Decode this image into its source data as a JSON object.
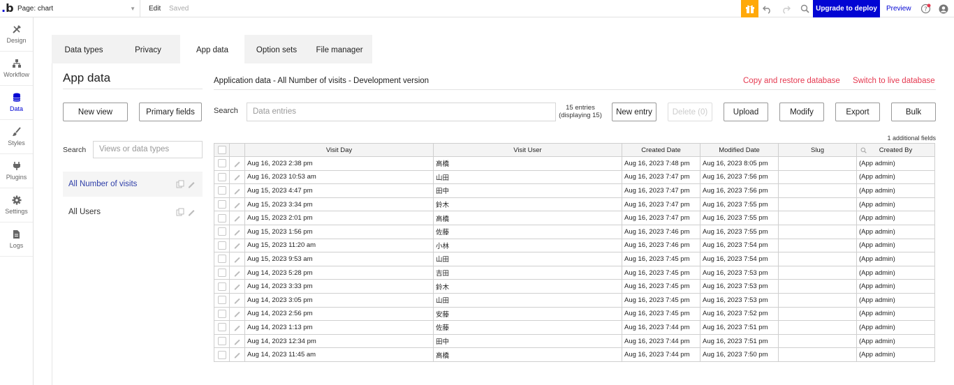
{
  "topbar": {
    "logo": "b",
    "page_label": "Page: chart",
    "edit": "Edit",
    "saved": "Saved",
    "upgrade": "Upgrade to deploy",
    "preview": "Preview",
    "accent": "#0205d3",
    "gift_color": "#ffa90a"
  },
  "rail": [
    {
      "label": "Design",
      "icon": "design-icon"
    },
    {
      "label": "Workflow",
      "icon": "workflow-icon"
    },
    {
      "label": "Data",
      "icon": "database-icon"
    },
    {
      "label": "Styles",
      "icon": "brush-icon"
    },
    {
      "label": "Plugins",
      "icon": "plug-icon"
    },
    {
      "label": "Settings",
      "icon": "gear-icon"
    },
    {
      "label": "Logs",
      "icon": "document-icon"
    }
  ],
  "tabs": [
    "Data types",
    "Privacy",
    "App data",
    "Option sets",
    "File manager"
  ],
  "left": {
    "title": "App data",
    "new_view": "New view",
    "primary_fields": "Primary fields",
    "search_label": "Search",
    "search_placeholder": "Views or data types",
    "items": [
      "All Number of visits",
      "All Users"
    ]
  },
  "right": {
    "header": "Application data - All Number of visits - Development version",
    "copy_restore": "Copy and restore database",
    "switch_live": "Switch to live database",
    "search_label": "Search",
    "search_placeholder": "Data entries",
    "entries_line1": "15 entries",
    "entries_line2": "(displaying 15)",
    "buttons": {
      "new_entry": "New entry",
      "delete": "Delete (0)",
      "upload": "Upload",
      "modify": "Modify",
      "export": "Export",
      "bulk": "Bulk"
    },
    "additional_fields": "1 additional fields",
    "columns": [
      "Visit Day",
      "Visit User",
      "Created Date",
      "Modified Date",
      "Slug",
      "Created By"
    ],
    "rows": [
      [
        "Aug 16, 2023 2:38 pm",
        "高橋",
        "Aug 16, 2023 7:48 pm",
        "Aug 16, 2023 8:05 pm",
        "",
        "(App admin)"
      ],
      [
        "Aug 16, 2023 10:53 am",
        "山田",
        "Aug 16, 2023 7:47 pm",
        "Aug 16, 2023 7:56 pm",
        "",
        "(App admin)"
      ],
      [
        "Aug 15, 2023 4:47 pm",
        "田中",
        "Aug 16, 2023 7:47 pm",
        "Aug 16, 2023 7:56 pm",
        "",
        "(App admin)"
      ],
      [
        "Aug 15, 2023 3:34 pm",
        "鈴木",
        "Aug 16, 2023 7:47 pm",
        "Aug 16, 2023 7:55 pm",
        "",
        "(App admin)"
      ],
      [
        "Aug 15, 2023 2:01 pm",
        "高橋",
        "Aug 16, 2023 7:47 pm",
        "Aug 16, 2023 7:55 pm",
        "",
        "(App admin)"
      ],
      [
        "Aug 15, 2023 1:56 pm",
        "佐藤",
        "Aug 16, 2023 7:46 pm",
        "Aug 16, 2023 7:55 pm",
        "",
        "(App admin)"
      ],
      [
        "Aug 15, 2023 11:20 am",
        "小林",
        "Aug 16, 2023 7:46 pm",
        "Aug 16, 2023 7:54 pm",
        "",
        "(App admin)"
      ],
      [
        "Aug 15, 2023 9:53 am",
        "山田",
        "Aug 16, 2023 7:45 pm",
        "Aug 16, 2023 7:54 pm",
        "",
        "(App admin)"
      ],
      [
        "Aug 14, 2023 5:28 pm",
        "吉田",
        "Aug 16, 2023 7:45 pm",
        "Aug 16, 2023 7:53 pm",
        "",
        "(App admin)"
      ],
      [
        "Aug 14, 2023 3:33 pm",
        "鈴木",
        "Aug 16, 2023 7:45 pm",
        "Aug 16, 2023 7:53 pm",
        "",
        "(App admin)"
      ],
      [
        "Aug 14, 2023 3:05 pm",
        "山田",
        "Aug 16, 2023 7:45 pm",
        "Aug 16, 2023 7:53 pm",
        "",
        "(App admin)"
      ],
      [
        "Aug 14, 2023 2:56 pm",
        "安藤",
        "Aug 16, 2023 7:45 pm",
        "Aug 16, 2023 7:52 pm",
        "",
        "(App admin)"
      ],
      [
        "Aug 14, 2023 1:13 pm",
        "佐藤",
        "Aug 16, 2023 7:44 pm",
        "Aug 16, 2023 7:51 pm",
        "",
        "(App admin)"
      ],
      [
        "Aug 14, 2023 12:34 pm",
        "田中",
        "Aug 16, 2023 7:44 pm",
        "Aug 16, 2023 7:51 pm",
        "",
        "(App admin)"
      ],
      [
        "Aug 14, 2023 11:45 am",
        "高橋",
        "Aug 16, 2023 7:44 pm",
        "Aug 16, 2023 7:50 pm",
        "",
        "(App admin)"
      ]
    ],
    "link_color": "#e53950"
  }
}
